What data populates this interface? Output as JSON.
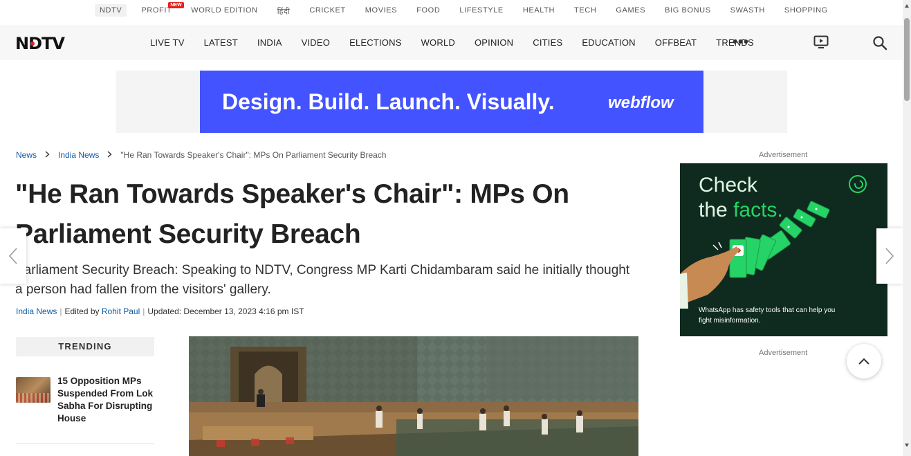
{
  "top_strip": {
    "items": [
      "NDTV",
      "PROFIT",
      "WORLD EDITION",
      "हिंदी",
      "CRICKET",
      "MOVIES",
      "FOOD",
      "LIFESTYLE",
      "HEALTH",
      "TECH",
      "GAMES",
      "BIG BONUS",
      "SWASTH",
      "SHOPPING"
    ],
    "new_badge": "NEW"
  },
  "main_nav": {
    "logo": "NDTV",
    "items": [
      "LIVE TV",
      "LATEST",
      "INDIA",
      "VIDEO",
      "ELECTIONS",
      "WORLD",
      "OPINION",
      "CITIES",
      "EDUCATION",
      "OFFBEAT",
      "TRENDS"
    ],
    "more_icon": "•••"
  },
  "top_ad": {
    "tagline": "Design. Build. Launch. Visually.",
    "brand": "webflow",
    "color": "#4353ff"
  },
  "breadcrumb": {
    "home": "News",
    "section": "India News",
    "current": "\"He Ran Towards Speaker's Chair\": MPs On Parliament Security Breach"
  },
  "article": {
    "headline": "\"He Ran Towards Speaker's Chair\": MPs On Parliament Security Breach",
    "summary": "Parliament Security Breach: Speaking to NDTV, Congress MP Karti Chidambaram said he initially thought a person had fallen from the visitors' gallery.",
    "category": "India News",
    "edited_by_prefix": "Edited by",
    "editor": "Rohit Paul",
    "updated": "Updated: December 13, 2023 4:16 pm IST"
  },
  "trending": {
    "heading": "TRENDING",
    "items": [
      {
        "title": "15 Opposition MPs Suspended From Lok Sabha For Disrupting House"
      }
    ]
  },
  "side_ad": {
    "label": "Advertisement",
    "line1": "Check",
    "line2_plain": "the",
    "line2_highlight": "facts.",
    "footnote": "WhatsApp has safety tools that can help you fight misinformation.",
    "label_bottom": "Advertisement",
    "accent": "#25d366"
  },
  "icons": {
    "tv": "tv-icon",
    "search": "search-icon",
    "prev": "chevron-left-icon",
    "next": "chevron-right-icon",
    "scroll_top": "chevron-up-icon"
  }
}
